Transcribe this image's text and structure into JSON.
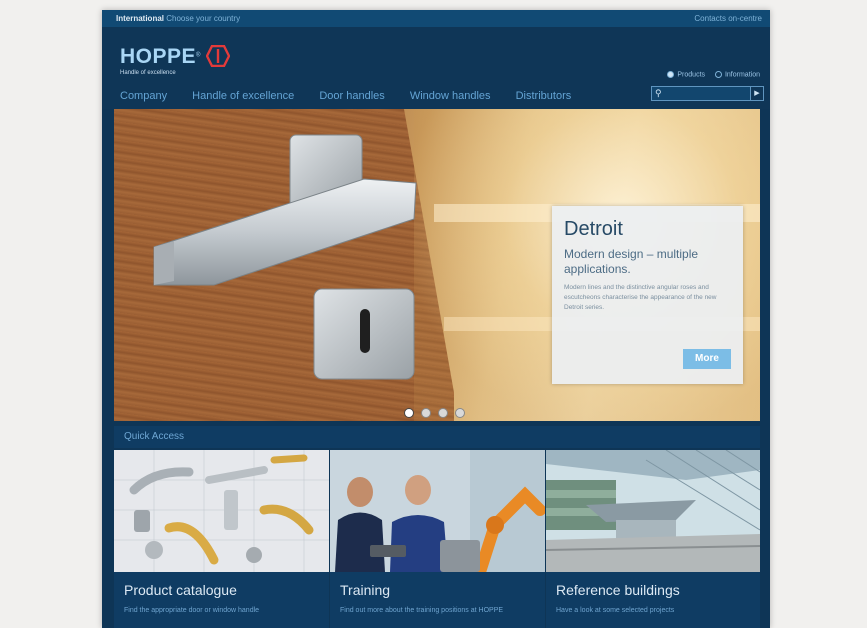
{
  "topbar": {
    "region_label": "International",
    "country_link": "Choose your country",
    "contact_link": "Contacts on-centre"
  },
  "header": {
    "logo_text": "HOPPE",
    "logo_tagline": "Handle of excellence",
    "search_scope": [
      "Products",
      "Information"
    ],
    "search_scope_selected": "Products",
    "search_placeholder": ""
  },
  "nav": {
    "items": [
      "Company",
      "Handle of excellence",
      "Door handles",
      "Window handles",
      "Distributors"
    ]
  },
  "hero": {
    "title": "Detroit",
    "subtitle": "Modern design – multiple applications.",
    "body": "Modern lines and the distinctive angular roses and escutcheons characterise the appearance of the new Detroit series.",
    "button_label": "More",
    "slide_count": 4,
    "active_slide": 1
  },
  "quick_access": {
    "heading": "Quick Access",
    "tiles": [
      {
        "title": "Product catalogue",
        "subtitle": "Find the appropriate door or window handle"
      },
      {
        "title": "Training",
        "subtitle": "Find out more about the training positions at HOPPE"
      },
      {
        "title": "Reference buildings",
        "subtitle": "Have a look at some selected projects"
      }
    ]
  },
  "colors": {
    "brand_navy": "#0e3556",
    "brand_light_blue": "#a9d6f5",
    "logo_red": "#e23a3a",
    "accent_button": "#7cbde6"
  }
}
